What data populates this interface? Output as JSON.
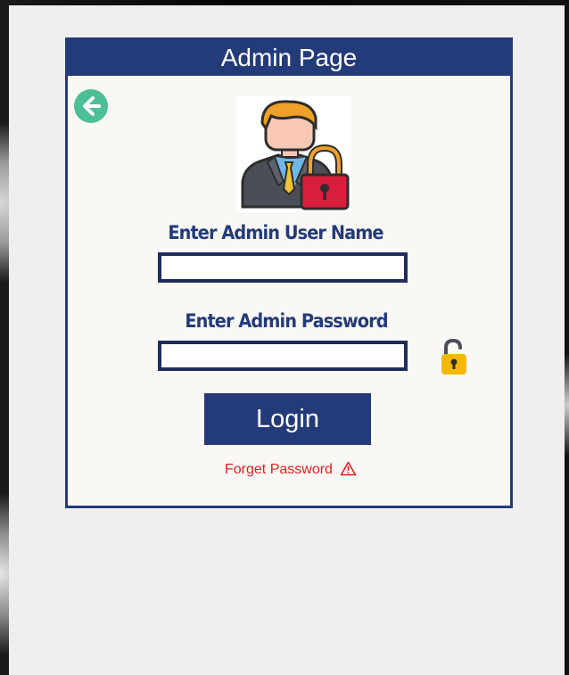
{
  "page": {
    "title": "Admin Page"
  },
  "form": {
    "username_label": "Enter Admin User Name",
    "username_value": "",
    "password_label": "Enter Admin Password",
    "password_value": "",
    "login_label": "Login",
    "forget_label": "Forget Password"
  },
  "icons": {
    "back": "arrow-left-circle-icon",
    "avatar": "admin-lock-avatar-icon",
    "password_toggle": "open-padlock-icon",
    "warning": "warning-triangle-icon"
  },
  "colors": {
    "accent": "#243b7a",
    "back_button": "#4cbf96",
    "warning_text": "#e02020",
    "padlock": "#f5b800"
  }
}
